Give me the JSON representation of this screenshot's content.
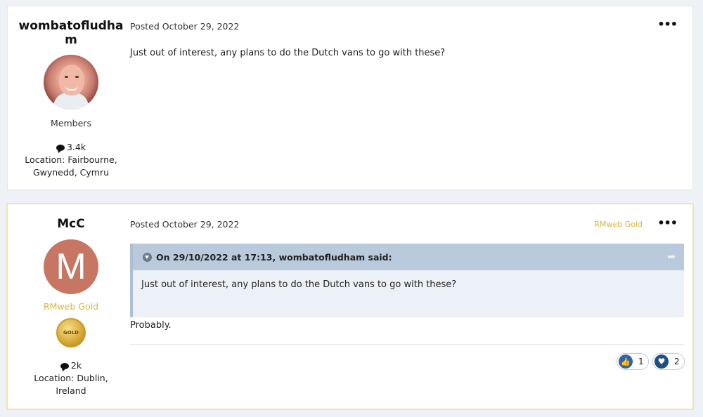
{
  "posts": [
    {
      "author": "wombatofludham",
      "author_wrapped_line1": "wombatofludha",
      "author_wrapped_line2": "m",
      "group": "Members",
      "posts_count": "3.4k",
      "location_line1": "Location: Fairbourne,",
      "location_line2": "Gwynedd, Cymru",
      "posted": "Posted October 29, 2022",
      "menu": "•••",
      "body": "Just out of interest, any plans to do the Dutch vans to go with these?"
    },
    {
      "author": "McC",
      "avatar_letter": "M",
      "group": "RMweb Gold",
      "badge_text": "GOLD",
      "posts_count": "2k",
      "location_line1": "Location: Dublin,",
      "location_line2": "Ireland",
      "posted": "Posted October 29, 2022",
      "tag": "RMweb Gold",
      "menu": "•••",
      "quote_header": "On 29/10/2022 at 17:13, wombatofludham said:",
      "quote_body": "Just out of interest, any plans to do the Dutch vans to go with these?",
      "body": "Probably.",
      "reactions": [
        {
          "icon": "thumbs-up",
          "glyph": "👍",
          "count": "1"
        },
        {
          "icon": "heart",
          "glyph": "♥",
          "count": "2"
        }
      ]
    }
  ],
  "colors": {
    "gold": "#d7b53c",
    "avatar_bg": "#c87664",
    "quote_header": "#b9cadc",
    "quote_body": "#ecf0f7"
  }
}
